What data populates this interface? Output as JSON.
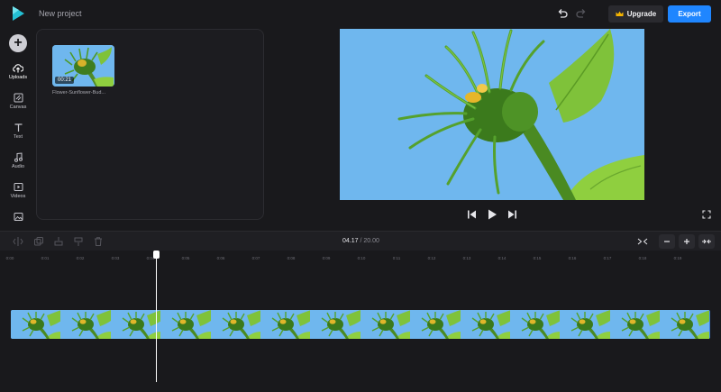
{
  "header": {
    "project_title": "New project",
    "upgrade_label": "Upgrade",
    "export_label": "Export"
  },
  "sidebar": {
    "items": [
      {
        "label": "Uploads",
        "icon": "cloud-upload-icon"
      },
      {
        "label": "Canvas",
        "icon": "canvas-icon"
      },
      {
        "label": "Text",
        "icon": "text-icon"
      },
      {
        "label": "Audio",
        "icon": "music-note-icon"
      },
      {
        "label": "Videos",
        "icon": "video-icon"
      },
      {
        "label": "",
        "icon": "image-icon"
      }
    ]
  },
  "media": {
    "items": [
      {
        "name": "Flower-Sunflower-Bud...",
        "duration": "00:21"
      }
    ]
  },
  "timeline": {
    "current_time": "04.17",
    "separator": "/",
    "total_time": "20.00",
    "ruler_labels": [
      "0:00",
      "0:01",
      "0:02",
      "0:03",
      "0:04",
      "0:05",
      "0:06",
      "0:07",
      "0:08",
      "0:09",
      "0:10",
      "0:11",
      "0:12",
      "0:13",
      "0:14",
      "0:15",
      "0:16",
      "0:17",
      "0:18",
      "0:19"
    ]
  },
  "colors": {
    "accent": "#1f86ff",
    "background": "#19191c",
    "track": "#3a7fe0",
    "sky": "#6fb7ee"
  }
}
